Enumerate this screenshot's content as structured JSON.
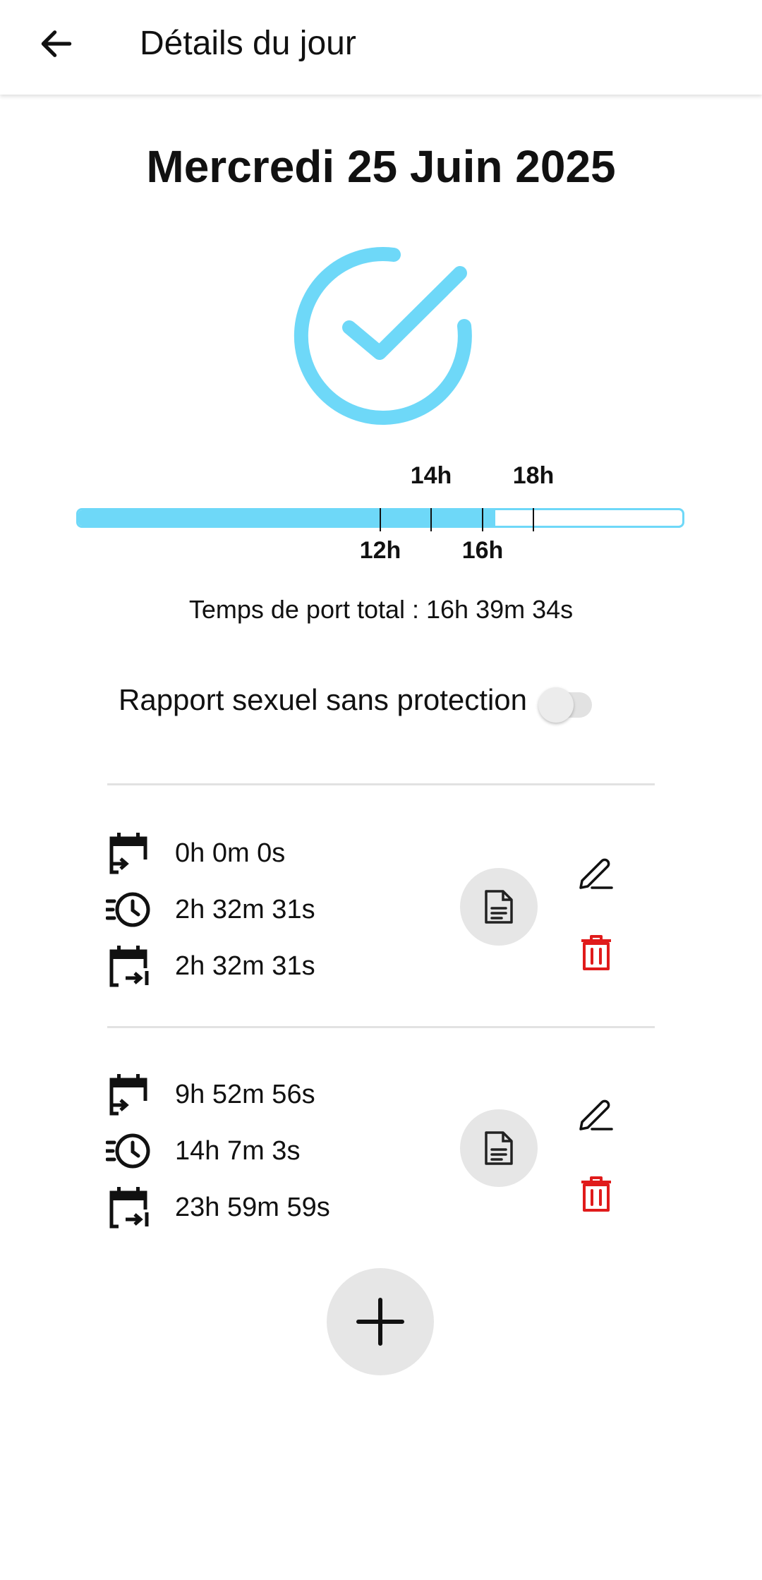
{
  "appbar": {
    "title": "Détails du jour",
    "back_icon": "arrow-left-icon"
  },
  "date": "Mercredi 25 Juin 2025",
  "status": {
    "icon": "check-circle-icon",
    "color": "#6ed8f8"
  },
  "progress": {
    "fill_fraction": 0.69,
    "tick_labels_top": [
      "14h",
      "18h"
    ],
    "tick_labels_bottom": [
      "12h",
      "16h"
    ]
  },
  "total_text": "Temps de port total : 16h 39m 34s",
  "toggle": {
    "label": "Rapport sexuel sans protection",
    "on": false
  },
  "entries": [
    {
      "start": "0h 0m 0s",
      "duration": "2h 32m 31s",
      "end": "2h 32m 31s",
      "start_icon": "calendar-start-icon",
      "duration_icon": "clock-history-icon",
      "end_icon": "calendar-end-icon"
    },
    {
      "start": "9h 52m 56s",
      "duration": "14h 7m 3s",
      "end": "23h 59m 59s",
      "start_icon": "calendar-start-icon",
      "duration_icon": "clock-history-icon",
      "end_icon": "calendar-end-icon"
    }
  ],
  "actions": {
    "note_icon": "document-icon",
    "edit_icon": "pencil-icon",
    "delete_icon": "trash-icon",
    "delete_color": "#e01b1b",
    "add_icon": "plus-icon"
  }
}
